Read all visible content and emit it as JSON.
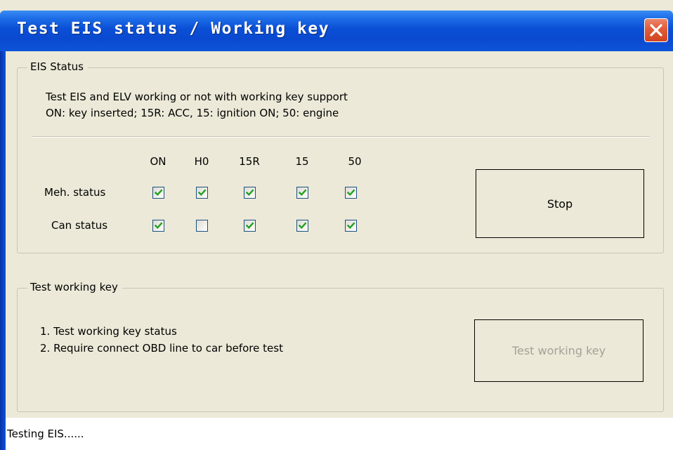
{
  "window": {
    "title": "Test EIS status / Working key",
    "close_icon": "close-icon"
  },
  "eis_status": {
    "group_label": "EIS Status",
    "description_line1": "Test EIS and ELV working or not with working key support",
    "description_line2": "ON: key inserted; 15R: ACC, 15: ignition ON; 50: engine",
    "columns": [
      "ON",
      "H0",
      "15R",
      "15",
      "50"
    ],
    "rows": [
      {
        "label": "Meh. status",
        "checked": [
          true,
          true,
          true,
          true,
          true
        ]
      },
      {
        "label": "Can status",
        "checked": [
          true,
          false,
          true,
          true,
          true
        ]
      }
    ],
    "stop_button": "Stop"
  },
  "working_key": {
    "group_label": "Test working key",
    "line1": "1. Test working key status",
    "line2": "2. Require connect OBD line to car before test",
    "test_button": "Test working key",
    "test_button_enabled": false
  },
  "status_bar": {
    "text": "Testing EIS......"
  },
  "colors": {
    "titlebar": "#0a4fd6",
    "close_button": "#e25f3c",
    "checkmark": "#21a121",
    "checkbox_border": "#1c5180",
    "dialog_bg": "#ece9d8",
    "disabled_text": "#a3a297"
  }
}
